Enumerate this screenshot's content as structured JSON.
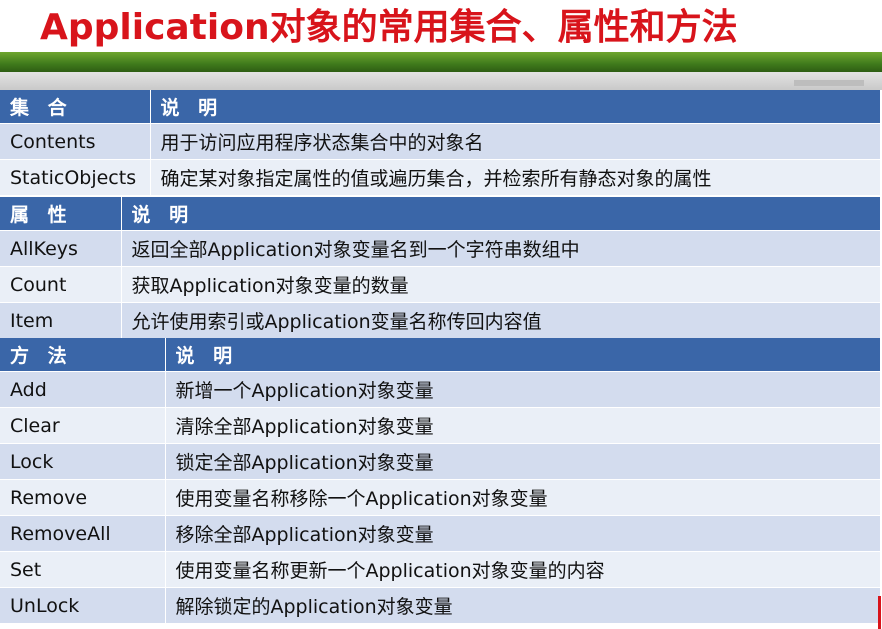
{
  "title": "Application对象的常用集合、属性和方法",
  "collections": {
    "headers": [
      "集 合",
      "说 明"
    ],
    "rows": [
      [
        "Contents",
        "用于访问应用程序状态集合中的对象名"
      ],
      [
        "StaticObjects",
        "确定某对象指定属性的值或遍历集合，并检索所有静态对象的属性"
      ]
    ]
  },
  "properties": {
    "headers": [
      "属 性",
      "说 明"
    ],
    "rows": [
      [
        "AllKeys",
        "返回全部Application对象变量名到一个字符串数组中"
      ],
      [
        "Count",
        "获取Application对象变量的数量"
      ],
      [
        "Item",
        "允许使用索引或Application变量名称传回内容值"
      ]
    ]
  },
  "methods": {
    "headers": [
      "方 法",
      "说 明"
    ],
    "rows": [
      [
        "Add",
        "新增一个Application对象变量"
      ],
      [
        "Clear",
        "清除全部Application对象变量"
      ],
      [
        "Lock",
        "锁定全部Application对象变量"
      ],
      [
        "Remove",
        "使用变量名称移除一个Application对象变量"
      ],
      [
        "RemoveAll",
        "移除全部Application对象变量"
      ],
      [
        "Set",
        "使用变量名称更新一个Application对象变量的内容"
      ],
      [
        "UnLock",
        "解除锁定的Application对象变量"
      ]
    ]
  }
}
